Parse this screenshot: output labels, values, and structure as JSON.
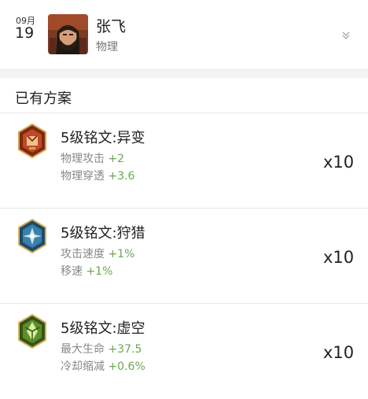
{
  "header": {
    "month": "09月",
    "day": "19",
    "hero_name": "张飞",
    "hero_type": "物理",
    "expand_icon": "chevron-down-icon"
  },
  "section": {
    "title": "已有方案"
  },
  "runes": [
    {
      "name": "5级铭文:异变",
      "icon": "rune-red-hexagon-icon",
      "color": "#c0492a",
      "attrs": [
        {
          "label": "物理攻击",
          "value": "+2"
        },
        {
          "label": "物理穿透",
          "value": "+3.6"
        }
      ],
      "count": "x10"
    },
    {
      "name": "5级铭文:狩猎",
      "icon": "rune-blue-hexagon-icon",
      "color": "#3c7fa8",
      "attrs": [
        {
          "label": "攻击速度",
          "value": "+1%"
        },
        {
          "label": "移速",
          "value": "+1%"
        }
      ],
      "count": "x10"
    },
    {
      "name": "5级铭文:虚空",
      "icon": "rune-green-hexagon-icon",
      "color": "#5e8f2a",
      "attrs": [
        {
          "label": "最大生命",
          "value": "+37.5"
        },
        {
          "label": "冷却缩减",
          "value": "+0.6%"
        }
      ],
      "count": "x10"
    }
  ]
}
